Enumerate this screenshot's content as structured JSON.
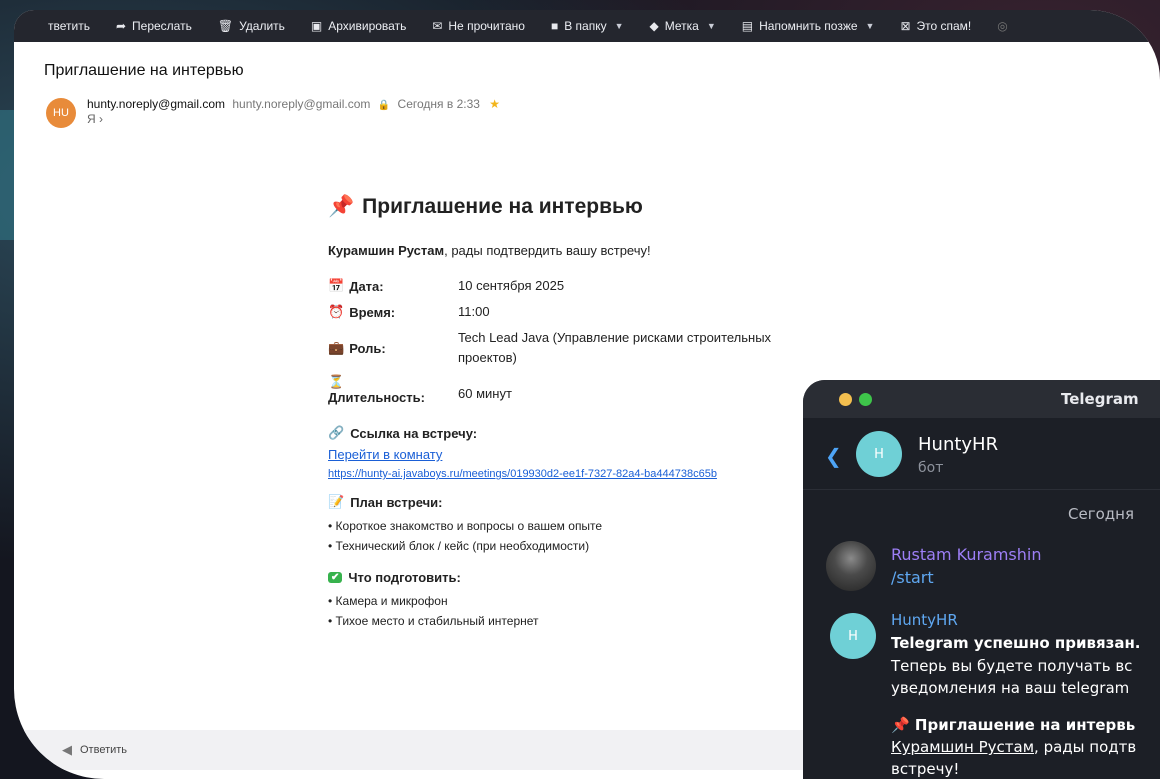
{
  "toolbar": {
    "items": [
      {
        "label": "тветить",
        "icon": "reply-icon"
      },
      {
        "label": "Переслать",
        "icon": "forward-icon"
      },
      {
        "label": "Удалить",
        "icon": "trash-icon"
      },
      {
        "label": "Архивировать",
        "icon": "archive-icon"
      },
      {
        "label": "Не прочитано",
        "icon": "envelope-icon"
      },
      {
        "label": "В папку",
        "icon": "folder-icon"
      },
      {
        "label": "Метка",
        "icon": "tag-icon"
      },
      {
        "label": "Напомнить позже",
        "icon": "reminder-icon"
      },
      {
        "label": "Это спам!",
        "icon": "spam-icon"
      }
    ]
  },
  "email": {
    "subject": "Приглашение на интервью",
    "avatar_initials": "HU",
    "from_name": "hunty.noreply@gmail.com",
    "from_address": "hunty.noreply@gmail.com",
    "date": "Сегодня в 2:33",
    "to": "Я ›",
    "body": {
      "heading": "Приглашение на интервью",
      "greeting_name": "Курамшин Рустам",
      "greeting_rest": ", рады подтвердить вашу встречу!",
      "fields": [
        {
          "key": "Дата:",
          "value": "10 сентября 2025"
        },
        {
          "key": "Время:",
          "value": "11:00"
        },
        {
          "key": "Роль:",
          "value": "Tech Lead Java (Управление рисками строительных проектов)"
        },
        {
          "key": "Длительность:",
          "value": "60 минут"
        }
      ],
      "link_section": "Ссылка на встречу:",
      "link_text": "Перейти в комнату",
      "link_url": "https://hunty-ai.javaboys.ru/meetings/019930d2-ee1f-7327-82a4-ba444738c65b",
      "plan_title": "План встречи:",
      "plan_items": [
        "• Короткое знакомство и вопросы о вашем опыте",
        "• Технический блок / кейс (при необходимости)"
      ],
      "prepare_title": "Что подготовить:",
      "prepare_items": [
        "• Камера и микрофон",
        "• Тихое место и стабильный интернет"
      ]
    },
    "reply_label": "Ответить"
  },
  "telegram": {
    "window_title": "Telegram",
    "chat_name": "HuntyHR",
    "chat_sub": "бот",
    "avatar_letter": "H",
    "date_divider": "Сегодня",
    "messages": [
      {
        "sender": "Rustam Kuramshin",
        "sender_color": "#9d7ff5",
        "text": "/start"
      },
      {
        "sender": "HuntyHR",
        "sender_color": "#5fa8f2",
        "bold": "Telegram успешно привязан.",
        "line1": "Теперь вы будете получать вс",
        "line2": "уведомления на ваш telegram",
        "invite": "Приглашение на интервь",
        "invite_name": "Курамшин Рустам",
        "invite_rest": ", рады подтв",
        "tail": "встречу!"
      }
    ],
    "colors": {
      "accent": "#4ea4f6",
      "avatar": "#6fd0d6"
    }
  }
}
